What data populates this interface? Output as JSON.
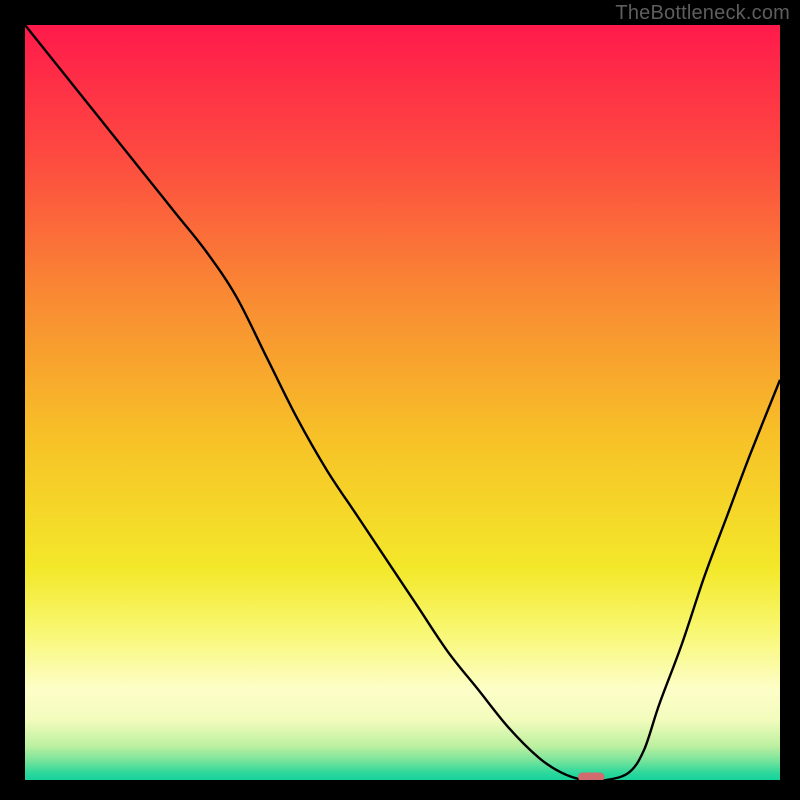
{
  "watermark": "TheBottleneck.com",
  "chart_data": {
    "type": "line",
    "title": "",
    "xlabel": "",
    "ylabel": "",
    "xlim": [
      0,
      100
    ],
    "ylim": [
      0,
      100
    ],
    "grid": false,
    "legend": false,
    "background": {
      "type": "vertical_gradient",
      "stops": [
        {
          "pos": 0.0,
          "color": "#ff1a4b"
        },
        {
          "pos": 0.18,
          "color": "#fd4c40"
        },
        {
          "pos": 0.36,
          "color": "#f98a33"
        },
        {
          "pos": 0.55,
          "color": "#f7c227"
        },
        {
          "pos": 0.72,
          "color": "#f3e82a"
        },
        {
          "pos": 0.8,
          "color": "#f8f76f"
        },
        {
          "pos": 0.88,
          "color": "#fdfec8"
        },
        {
          "pos": 0.92,
          "color": "#f3fcbd"
        },
        {
          "pos": 0.955,
          "color": "#bdf0a0"
        },
        {
          "pos": 0.975,
          "color": "#74e39b"
        },
        {
          "pos": 0.99,
          "color": "#2fd89c"
        },
        {
          "pos": 1.0,
          "color": "#15d39c"
        }
      ]
    },
    "series": [
      {
        "name": "bottleneck-curve",
        "color": "#000000",
        "stroke_width": 2.4,
        "x": [
          0,
          4,
          8,
          12,
          16,
          20,
          24,
          28,
          32,
          36,
          40,
          44,
          48,
          52,
          56,
          60,
          64,
          68,
          71,
          74,
          77,
          80,
          82,
          84,
          87,
          90,
          93,
          96,
          100
        ],
        "y": [
          100,
          95,
          90,
          85,
          80,
          75,
          70,
          64,
          56,
          48,
          41,
          35,
          29,
          23,
          17,
          12,
          7,
          3,
          1,
          0,
          0,
          1,
          4,
          10,
          18,
          27,
          35,
          43,
          53
        ]
      }
    ],
    "marker": {
      "shape": "capsule",
      "x": 75,
      "y": 0,
      "width_pct": 3.5,
      "height_pct": 1.2,
      "fill": "#d16b6d"
    }
  }
}
